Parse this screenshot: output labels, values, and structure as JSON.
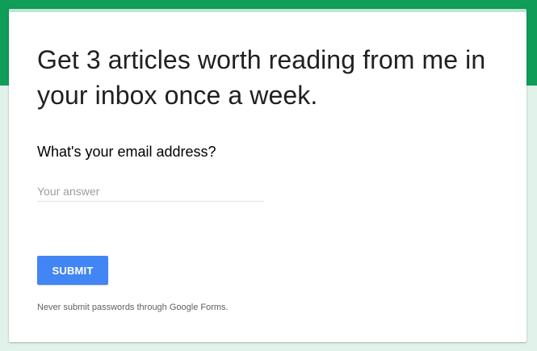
{
  "form": {
    "title": "Get 3 articles worth reading from me in your inbox once a week.",
    "question": {
      "label": "What's your email address?",
      "value": "",
      "placeholder": "Your answer"
    },
    "submit_label": "SUBMIT",
    "disclaimer": "Never submit passwords through Google Forms."
  },
  "colors": {
    "header_band": "#0f9d58",
    "page_background": "#e0f2e9",
    "card_accent": "#bde4cf",
    "submit_button": "#4285f4"
  }
}
